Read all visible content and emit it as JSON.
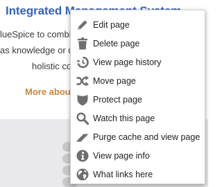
{
  "background": {
    "title": "Integrated Management System",
    "lines": [
      "lueSpice to combin",
      "as knowledge or qu",
      "holistic corp"
    ],
    "more_link": "More about"
  },
  "context_menu": {
    "items": [
      {
        "label": "Edit page",
        "icon": "pencil-icon"
      },
      {
        "label": "Delete page",
        "icon": "trash-icon"
      },
      {
        "label": "View page history",
        "icon": "history-icon"
      },
      {
        "label": "Move page",
        "icon": "shuffle-icon"
      },
      {
        "label": "Protect page",
        "icon": "shield-icon"
      },
      {
        "label": "Watch this page",
        "icon": "magnifier-icon"
      },
      {
        "label": "Purge cache and view page",
        "icon": "eraser-icon"
      },
      {
        "label": "View page info",
        "icon": "info-icon"
      },
      {
        "label": "What links here",
        "icon": "globe-icon"
      }
    ]
  },
  "colors": {
    "title": "#3563b8",
    "link": "#c8863a",
    "icon": "#6e6e6e",
    "band": "#e9e9eb"
  }
}
